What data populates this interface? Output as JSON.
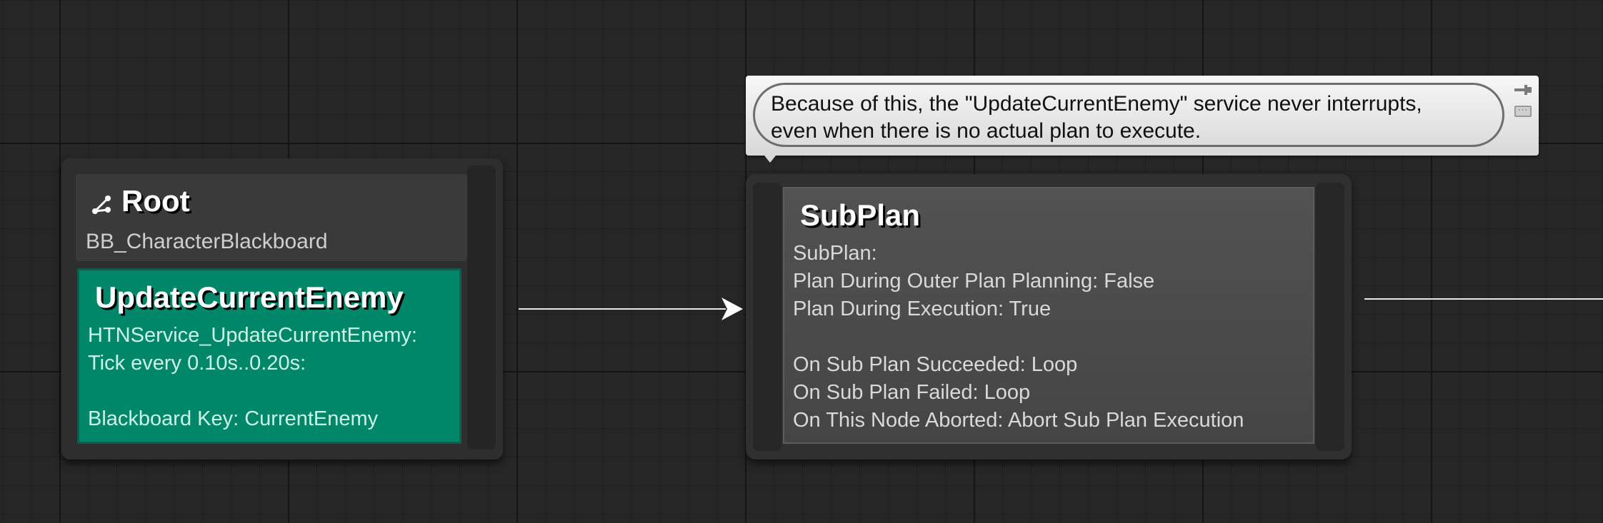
{
  "root_node": {
    "icon": "root-icon",
    "title": "Root",
    "subtitle": "BB_CharacterBlackboard",
    "service": {
      "title": "UpdateCurrentEnemy",
      "lines": [
        "HTNService_UpdateCurrentEnemy:",
        "Tick every 0.10s..0.20s:",
        "",
        "Blackboard Key: CurrentEnemy"
      ],
      "color": "#00876a"
    }
  },
  "comment": {
    "lines": [
      "Because of this, the \"UpdateCurrentEnemy\" service never interrupts,",
      "even when there is no actual plan to execute."
    ],
    "icons": [
      "pin-icon",
      "more-icon"
    ]
  },
  "subplan_node": {
    "title": "SubPlan",
    "lines": [
      "SubPlan:",
      "Plan During Outer Plan Planning: False",
      "Plan During Execution: True",
      "",
      "On Sub Plan Succeeded: Loop",
      "On Sub Plan Failed: Loop",
      "On This Node Aborted: Abort Sub Plan Execution"
    ]
  },
  "colors": {
    "background": "#262626",
    "wire": "#e6e6e6",
    "service_green": "#00876a"
  }
}
